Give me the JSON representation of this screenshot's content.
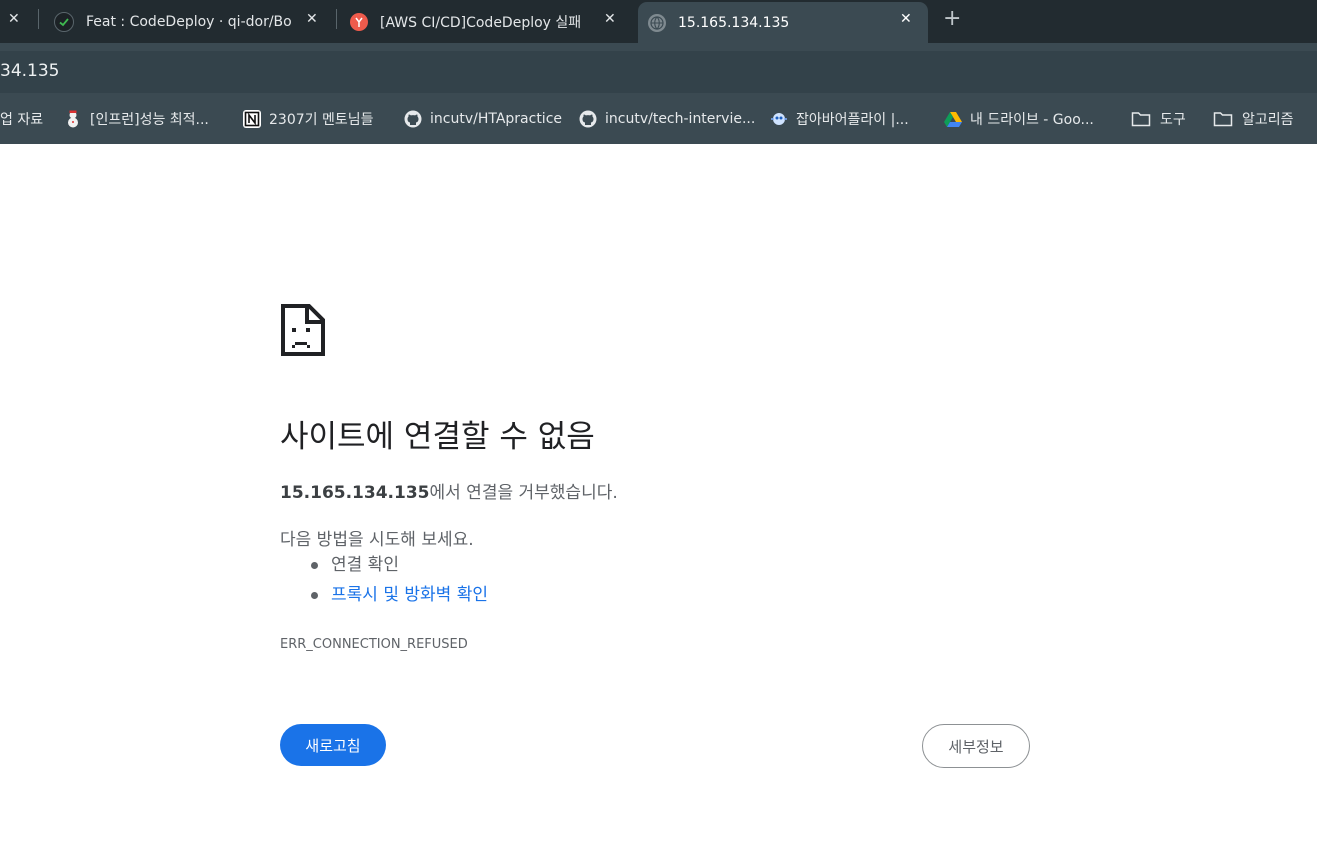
{
  "tabs": [
    {
      "title": "",
      "close": "✕"
    },
    {
      "title": "Feat : CodeDeploy · qi-dor/Bo",
      "close": "✕",
      "favicon": "github-check-icon"
    },
    {
      "title": "[AWS CI/CD]CodeDeploy 실패",
      "close": "✕",
      "favicon": "velog-icon",
      "favicon_color": "#ef5b4c"
    },
    {
      "title": "15.165.134.135",
      "close": "✕",
      "favicon": "globe-icon",
      "active": true
    }
  ],
  "new_tab": "+",
  "address": {
    "url": "34.135"
  },
  "bookmarks": [
    {
      "label": "업 자료"
    },
    {
      "label": "[인프런]성능 최적...",
      "icon": "snowman-icon"
    },
    {
      "label": "2307기 멘토님들",
      "icon": "notion-icon"
    },
    {
      "label": "incutv/HTApractice",
      "icon": "github-icon"
    },
    {
      "label": "incutv/tech-intervie...",
      "icon": "github-icon"
    },
    {
      "label": "잡아바어플라이 |...",
      "icon": "jobaba-icon"
    },
    {
      "label": "내 드라이브 - Goo...",
      "icon": "google-drive-icon"
    },
    {
      "label": "도구",
      "icon": "folder-icon"
    },
    {
      "label": "알고리즘",
      "icon": "folder-icon"
    }
  ],
  "error": {
    "heading": "사이트에 연결할 수 없음",
    "host": "15.165.134.135",
    "host_suffix": "에서 연결을 거부했습니다.",
    "try_intro": "다음 방법을 시도해 보세요.",
    "suggestions": [
      "연결 확인",
      "프록시 및 방화벽 확인"
    ],
    "code": "ERR_CONNECTION_REFUSED",
    "reload_label": "새로고침",
    "details_label": "세부정보"
  },
  "colors": {
    "accent": "#1a73e8",
    "tabstrip": "#222b30",
    "toolbar": "#3b4a52"
  }
}
